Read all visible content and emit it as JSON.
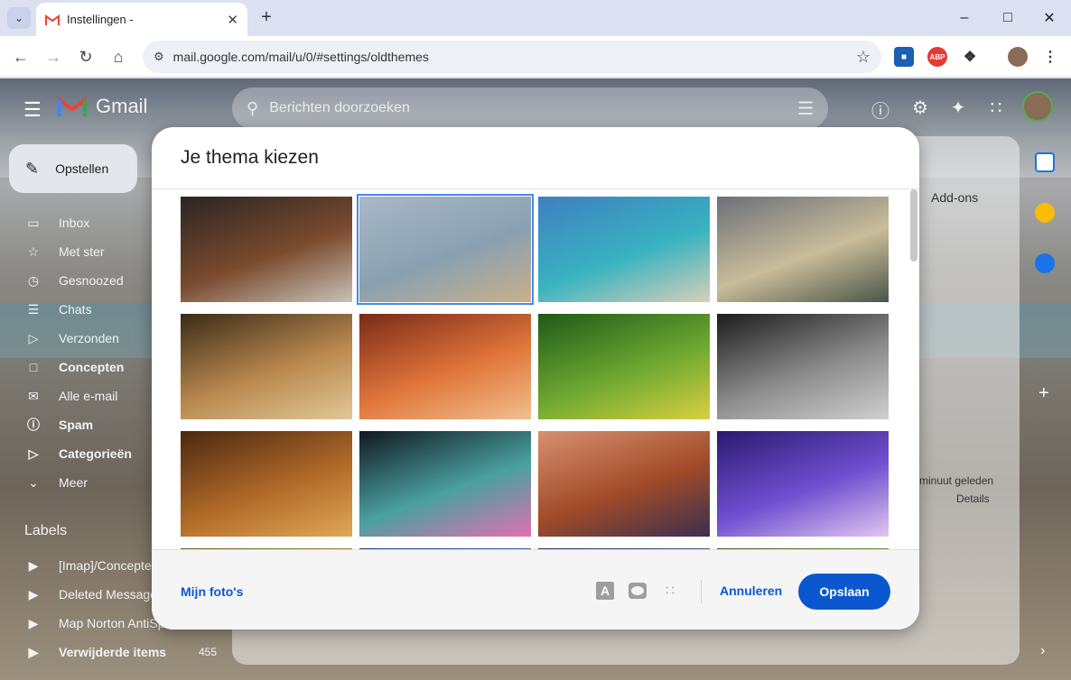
{
  "browser": {
    "tab_title": "Instellingen - ",
    "url": "mail.google.com/mail/u/0/#settings/oldthemes",
    "abp_label": "ABP"
  },
  "gmail": {
    "logo_text": "Gmail",
    "search_placeholder": "Berichten doorzoeken",
    "compose_label": "Opstellen",
    "nav": [
      {
        "label": "Inbox",
        "icon": "inbox-icon",
        "bold": false
      },
      {
        "label": "Met ster",
        "icon": "star-icon",
        "bold": false
      },
      {
        "label": "Gesnoozed",
        "icon": "clock-icon",
        "bold": false
      },
      {
        "label": "Chats",
        "icon": "chat-icon",
        "bold": false
      },
      {
        "label": "Verzonden",
        "icon": "send-icon",
        "bold": false
      },
      {
        "label": "Concepten",
        "icon": "draft-icon",
        "bold": true
      },
      {
        "label": "Alle e-mail",
        "icon": "mail-icon",
        "bold": false
      },
      {
        "label": "Spam",
        "icon": "spam-icon",
        "bold": true
      },
      {
        "label": "Categorieën",
        "icon": "label-icon",
        "bold": true
      },
      {
        "label": "Meer",
        "icon": "chevron-down-icon",
        "bold": false
      }
    ],
    "labels_title": "Labels",
    "labels": [
      {
        "label": "[Imap]/Concepten",
        "count": ""
      },
      {
        "label": "Deleted Messages",
        "count": ""
      },
      {
        "label": "Map Norton AntiSpam",
        "count": ""
      },
      {
        "label": "Verwijderde items",
        "count": "455",
        "bold": true
      }
    ],
    "addons_label": "Add-ons",
    "minute_text": "minuut geleden",
    "details_text": "Details"
  },
  "dialog": {
    "title": "Je thema kiezen",
    "my_photos": "Mijn foto's",
    "cancel": "Annuleren",
    "save": "Opslaan",
    "selected_index": 1,
    "themes": [
      {
        "name": "shop-front",
        "colors": [
          "#2a2522",
          "#7a4b2e",
          "#c7c2b8"
        ]
      },
      {
        "name": "beach-boats",
        "colors": [
          "#a8b8c8",
          "#8aa0b0",
          "#c9b08a"
        ]
      },
      {
        "name": "tropical-coast",
        "colors": [
          "#3f7fbf",
          "#38b3c0",
          "#d8cfb8"
        ]
      },
      {
        "name": "sunset-valley",
        "colors": [
          "#6b7078",
          "#c9bd9a",
          "#4a5548"
        ]
      },
      {
        "name": "chess",
        "colors": [
          "#3a2b18",
          "#b9894e",
          "#e0c898"
        ]
      },
      {
        "name": "canyon-rock",
        "colors": [
          "#7a2a18",
          "#e0763a",
          "#f0c090"
        ]
      },
      {
        "name": "caterpillar",
        "colors": [
          "#1e5a18",
          "#6fa830",
          "#d8d040"
        ]
      },
      {
        "name": "pipes",
        "colors": [
          "#1c1c1c",
          "#8c8c8c",
          "#d0d0d0"
        ]
      },
      {
        "name": "autumn-leaves",
        "colors": [
          "#4a2810",
          "#b06a28",
          "#e0a858"
        ]
      },
      {
        "name": "bokeh",
        "colors": [
          "#101820",
          "#4aa0a0",
          "#e070b0"
        ]
      },
      {
        "name": "horseshoe-bend",
        "colors": [
          "#d89070",
          "#a04a28",
          "#3a3050"
        ]
      },
      {
        "name": "jellyfish",
        "colors": [
          "#2a1a70",
          "#7050d0",
          "#e0c8f0"
        ]
      },
      {
        "name": "row4-a",
        "colors": [
          "#6a5a20",
          "#a89040",
          "#d0c070"
        ]
      },
      {
        "name": "row4-b",
        "colors": [
          "#1a3a70",
          "#3a70b0",
          "#80a8d0"
        ]
      },
      {
        "name": "row4-c",
        "colors": [
          "#203050",
          "#506890",
          "#a0b0c8"
        ]
      },
      {
        "name": "row4-d",
        "colors": [
          "#3a5a20",
          "#80a040",
          "#c0d080"
        ]
      }
    ]
  }
}
